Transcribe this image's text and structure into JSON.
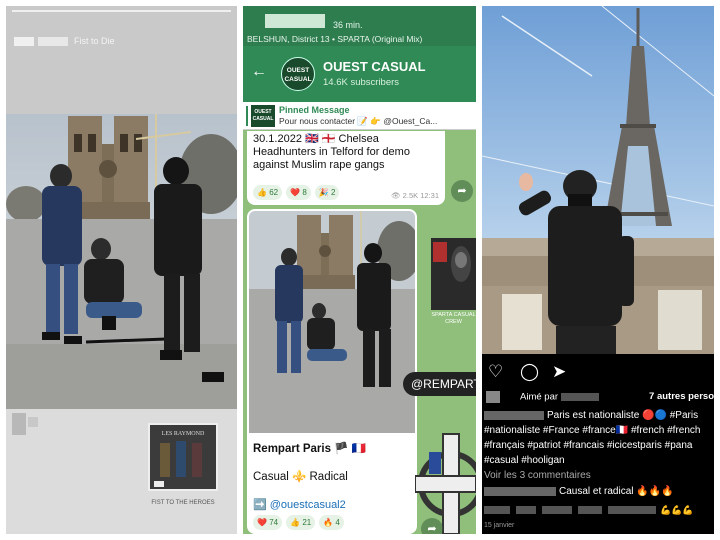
{
  "panel_story": {
    "header_text": "Fist to Die",
    "thumb_title": "LES RAYMOND",
    "thumb_caption": "FIST TO THE HEROES"
  },
  "panel_telegram": {
    "status_time": "36 min.",
    "status_track": "BELSHUN, District 13 • SPARTA (Original Mix)",
    "channel_name": "OUEST CASUAL",
    "channel_logo_text": "OUEST CASUAL",
    "subscribers": "14.6K subscribers",
    "pinned_title": "Pinned Message",
    "pinned_text": "Pour nous contacter 📝 👉 @Ouest_Ca...",
    "message1": {
      "text": "30.1.2022 🇬🇧 🏴󠁧󠁢󠁥󠁮󠁧󠁿 Chelsea Headhunters in Telford for demo against Muslim rape gangs",
      "reactions": [
        {
          "emoji": "👍",
          "count": "62"
        },
        {
          "emoji": "❤️",
          "count": "8"
        },
        {
          "emoji": "🎉",
          "count": "2"
        }
      ],
      "views": "👁 2.5K",
      "time": "12:31"
    },
    "message2": {
      "caption_title": "Rempart Paris 🏴 🇫🇷",
      "caption_line2": "Casual ⚜️ Radical",
      "caption_link": "➡️ @ouestcasual2",
      "reactions": [
        {
          "emoji": "❤️",
          "count": "74"
        },
        {
          "emoji": "👍",
          "count": "21"
        },
        {
          "emoji": "🔥",
          "count": "4"
        }
      ]
    },
    "side_caption": "SPARTA CASUAL CREW",
    "tag_pill": "@REMPART"
  },
  "panel_instagram": {
    "liked_by": "Aimé par",
    "likes_others": "7 autres perso",
    "caption_text": "Paris est nationaliste 🔴🔵 #Paris #nationaliste #France #france🇫🇷 #french #french #français #patriot #francais #icicestparis #pana #casual #hooligan",
    "view_comments": "Voir les 3 commentaires",
    "comment1": "Causal et radical 🔥🔥🔥",
    "comment2_emoji": "💪💪💪",
    "date": "15 janvier",
    "icons": [
      "heart-icon",
      "comment-icon",
      "share-icon"
    ]
  }
}
